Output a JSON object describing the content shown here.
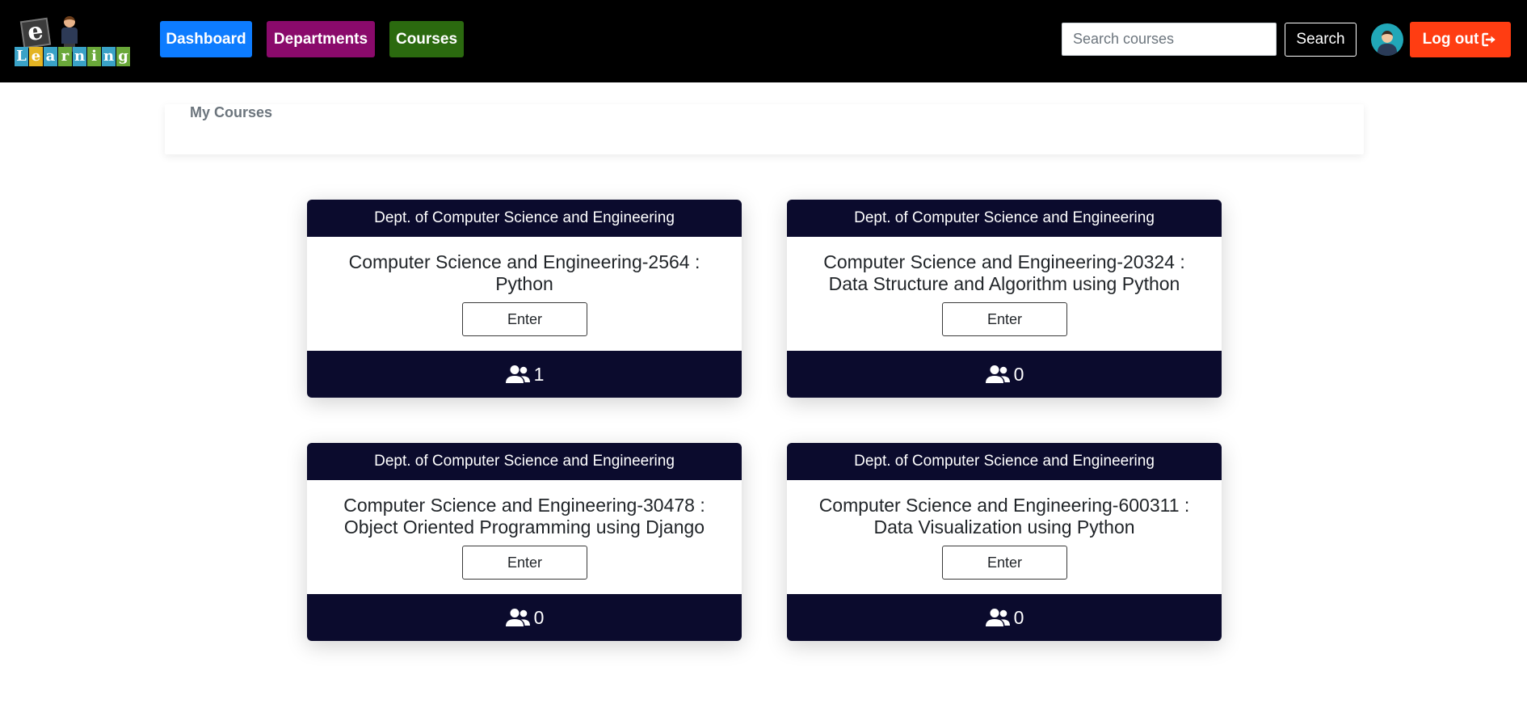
{
  "nav": {
    "logo_letters": [
      "e",
      "L",
      "e",
      "a",
      "r",
      "n",
      "i",
      "n",
      "g"
    ],
    "dashboard_label": "Dashboard",
    "departments_label": "Departments",
    "courses_label": "Courses",
    "search_placeholder": "Search courses",
    "search_value": "",
    "search_button": "Search",
    "logout_label": "Log out"
  },
  "page": {
    "title": "My Courses"
  },
  "courses": [
    {
      "department": "Dept. of Computer Science and Engineering",
      "title_line1": "Computer Science and Engineering-2564 :",
      "title_line2": "Python",
      "enter_label": "Enter",
      "students": "1"
    },
    {
      "department": "Dept. of Computer Science and Engineering",
      "title_line1": "Computer Science and Engineering-20324 :",
      "title_line2": "Data Structure and Algorithm using Python",
      "enter_label": "Enter",
      "students": "0"
    },
    {
      "department": "Dept. of Computer Science and Engineering",
      "title_line1": "Computer Science and Engineering-30478 :",
      "title_line2": "Object Oriented Programming using Django",
      "enter_label": "Enter",
      "students": "0"
    },
    {
      "department": "Dept. of Computer Science and Engineering",
      "title_line1": "Computer Science and Engineering-600311 :",
      "title_line2": "Data Visualization using Python",
      "enter_label": "Enter",
      "students": "0"
    }
  ],
  "icons": {
    "logout": "sign-out-icon",
    "students": "users-icon",
    "avatar": "user-avatar-icon"
  },
  "colors": {
    "navbar_bg": "#000000",
    "dashboard_btn": "#0d7cff",
    "departments_btn": "#8a0a6b",
    "courses_btn": "#2b6a0f",
    "logout_btn": "#ff3d12",
    "card_dark": "#0b0b2d"
  }
}
